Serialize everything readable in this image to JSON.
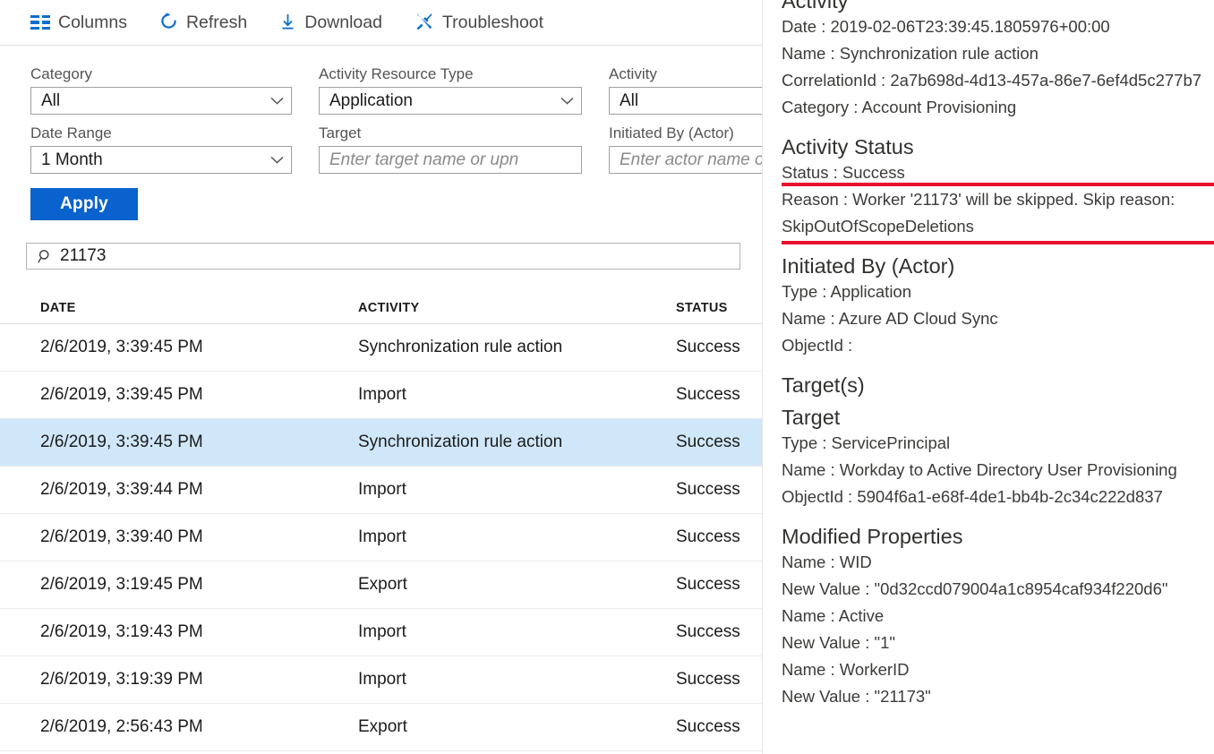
{
  "toolbar": {
    "items": [
      {
        "label": "Columns",
        "icon": "columns-icon"
      },
      {
        "label": "Refresh",
        "icon": "refresh-icon"
      },
      {
        "label": "Download",
        "icon": "download-icon"
      },
      {
        "label": "Troubleshoot",
        "icon": "troubleshoot-icon"
      }
    ]
  },
  "filters": {
    "category": {
      "label": "Category",
      "value": "All"
    },
    "activity_resource_type": {
      "label": "Activity Resource Type",
      "value": "Application"
    },
    "activity": {
      "label": "Activity",
      "value": "All"
    },
    "date_range": {
      "label": "Date Range",
      "value": "1 Month"
    },
    "target": {
      "label": "Target",
      "placeholder": "Enter target name or upn",
      "value": ""
    },
    "initiated_by": {
      "label": "Initiated By (Actor)",
      "placeholder": "Enter actor name or upn",
      "value": ""
    },
    "apply_label": "Apply"
  },
  "search": {
    "value": "21173",
    "placeholder": "",
    "icon": "search-icon"
  },
  "table": {
    "columns": [
      "DATE",
      "ACTIVITY",
      "STATUS"
    ],
    "rows": [
      {
        "date": "2/6/2019, 3:39:45 PM",
        "activity": "Synchronization rule action",
        "status": "Success",
        "selected": false
      },
      {
        "date": "2/6/2019, 3:39:45 PM",
        "activity": "Import",
        "status": "Success",
        "selected": false
      },
      {
        "date": "2/6/2019, 3:39:45 PM",
        "activity": "Synchronization rule action",
        "status": "Success",
        "selected": true
      },
      {
        "date": "2/6/2019, 3:39:44 PM",
        "activity": "Import",
        "status": "Success",
        "selected": false
      },
      {
        "date": "2/6/2019, 3:39:40 PM",
        "activity": "Import",
        "status": "Success",
        "selected": false
      },
      {
        "date": "2/6/2019, 3:19:45 PM",
        "activity": "Export",
        "status": "Success",
        "selected": false
      },
      {
        "date": "2/6/2019, 3:19:43 PM",
        "activity": "Import",
        "status": "Success",
        "selected": false
      },
      {
        "date": "2/6/2019, 3:19:39 PM",
        "activity": "Import",
        "status": "Success",
        "selected": false
      },
      {
        "date": "2/6/2019, 2:56:43 PM",
        "activity": "Export",
        "status": "Success",
        "selected": false
      }
    ]
  },
  "detail": {
    "activity": {
      "heading": "Activity",
      "date": "Date : 2019-02-06T23:39:45.1805976+00:00",
      "name": "Name : Synchronization rule action",
      "correlation_id": "CorrelationId : 2a7b698d-4d13-457a-86e7-6ef4d5c277b7",
      "category": "Category : Account Provisioning"
    },
    "activity_status": {
      "heading": "Activity Status",
      "status": "Status : Success",
      "reason": "Reason : Worker '21173' will be skipped. Skip reason: SkipOutOfScopeDeletions"
    },
    "initiated_by": {
      "heading": "Initiated By (Actor)",
      "type": "Type : Application",
      "name": "Name : Azure AD Cloud Sync",
      "object_id": "ObjectId :"
    },
    "targets": {
      "heading": "Target(s)",
      "target_heading": "Target",
      "type": "Type : ServicePrincipal",
      "name": "Name : Workday to Active Directory User Provisioning",
      "object_id": "ObjectId : 5904f6a1-e68f-4de1-bb4b-2c34c222d837"
    },
    "modified_properties": {
      "heading": "Modified Properties",
      "entries": [
        {
          "name": "Name : WID",
          "new_value": "New Value : \"0d32ccd079004a1c8954caf934f220d6\""
        },
        {
          "name": "Name : Active",
          "new_value": "New Value : \"1\""
        },
        {
          "name": "Name : WorkerID",
          "new_value": "New Value : \"21173\""
        }
      ]
    }
  },
  "colors": {
    "accent": "#0a62ce",
    "icon_blue": "#0a6ed0",
    "selected_row": "#cfe7f9",
    "highlight_red": "#e8112d"
  }
}
